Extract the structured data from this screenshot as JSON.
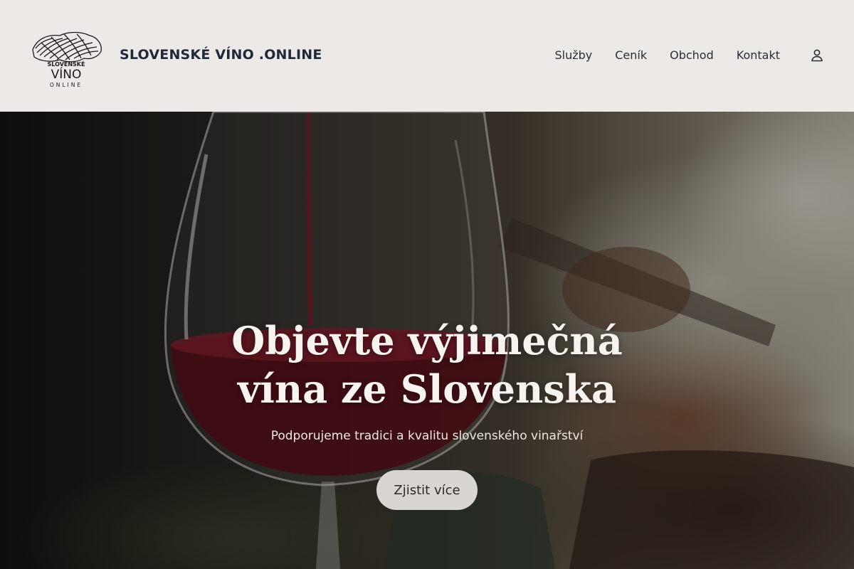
{
  "header": {
    "logo": {
      "top_text": "SLOVENSKÉ",
      "main_text": "VÍNO",
      "bottom_text": "ONLINE"
    },
    "site_title": "SLOVENSKÉ VÍNO .ONLINE",
    "nav": [
      {
        "label": "Služby"
      },
      {
        "label": "Ceník"
      },
      {
        "label": "Obchod"
      },
      {
        "label": "Kontakt"
      }
    ],
    "account_icon": "user-icon"
  },
  "hero": {
    "title_line1": "Objevte výjimečná",
    "title_line2": "vína ze Slovenska",
    "subtitle": "Podporujeme tradici a kvalitu slovenského vinařství",
    "button_label": "Zjistit více",
    "image_description_icon": "wine-glass-image"
  },
  "colors": {
    "header_bg": "#ECE9E6",
    "title_color": "#1E2A3A",
    "button_bg": "#D9D5D1",
    "wine": "#6B1420"
  }
}
